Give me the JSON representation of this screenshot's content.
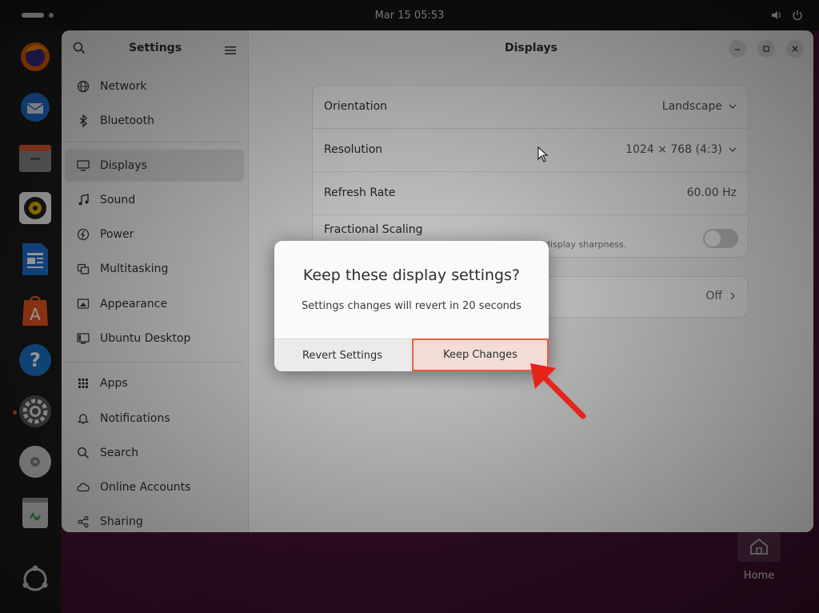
{
  "topbar": {
    "clock": "Mar 15  05:53"
  },
  "dock": {
    "items": [
      {
        "name": "firefox",
        "icon": "firefox-icon"
      },
      {
        "name": "thunderbird",
        "icon": "thunderbird-icon"
      },
      {
        "name": "files",
        "icon": "files-icon"
      },
      {
        "name": "rhythmbox",
        "icon": "rhythmbox-icon"
      },
      {
        "name": "libreoffice-writer",
        "icon": "writer-icon"
      },
      {
        "name": "app-center",
        "icon": "app-center-icon"
      },
      {
        "name": "help",
        "icon": "help-icon"
      },
      {
        "name": "settings",
        "icon": "settings-icon"
      },
      {
        "name": "optical-drive",
        "icon": "disc-icon"
      },
      {
        "name": "trash",
        "icon": "trash-icon"
      },
      {
        "name": "show-apps",
        "icon": "ubuntu-icon"
      }
    ]
  },
  "desktop": {
    "home_label": "Home"
  },
  "window": {
    "sidebar": {
      "title": "Settings",
      "items": [
        {
          "label": "Network",
          "icon": "network-icon"
        },
        {
          "label": "Bluetooth",
          "icon": "bluetooth-icon"
        },
        {
          "label": "Displays",
          "icon": "display-icon",
          "selected": true
        },
        {
          "label": "Sound",
          "icon": "music-note-icon"
        },
        {
          "label": "Power",
          "icon": "power-icon"
        },
        {
          "label": "Multitasking",
          "icon": "multitasking-icon"
        },
        {
          "label": "Appearance",
          "icon": "appearance-icon"
        },
        {
          "label": "Ubuntu Desktop",
          "icon": "ubuntu-desktop-icon"
        },
        {
          "label": "Apps",
          "icon": "apps-grid-icon"
        },
        {
          "label": "Notifications",
          "icon": "bell-icon"
        },
        {
          "label": "Search",
          "icon": "search-icon"
        },
        {
          "label": "Online Accounts",
          "icon": "cloud-icon"
        },
        {
          "label": "Sharing",
          "icon": "share-icon"
        }
      ]
    },
    "content": {
      "title": "Displays",
      "rows": {
        "orientation": {
          "label": "Orientation",
          "value": "Landscape"
        },
        "resolution": {
          "label": "Resolution",
          "value": "1024 × 768 (4:3)"
        },
        "refresh_rate": {
          "label": "Refresh Rate",
          "value": "60.00 Hz"
        },
        "fractional_scaling": {
          "label": "Fractional Scaling",
          "sub": "display sharpness."
        },
        "night_light": {
          "value": "Off"
        }
      }
    }
  },
  "dialog": {
    "title": "Keep these display settings?",
    "message": "Settings changes will revert in 20 seconds",
    "revert_label": "Revert Settings",
    "keep_label": "Keep Changes"
  },
  "colors": {
    "accent": "#e95420",
    "annotation": "#e8231a"
  }
}
